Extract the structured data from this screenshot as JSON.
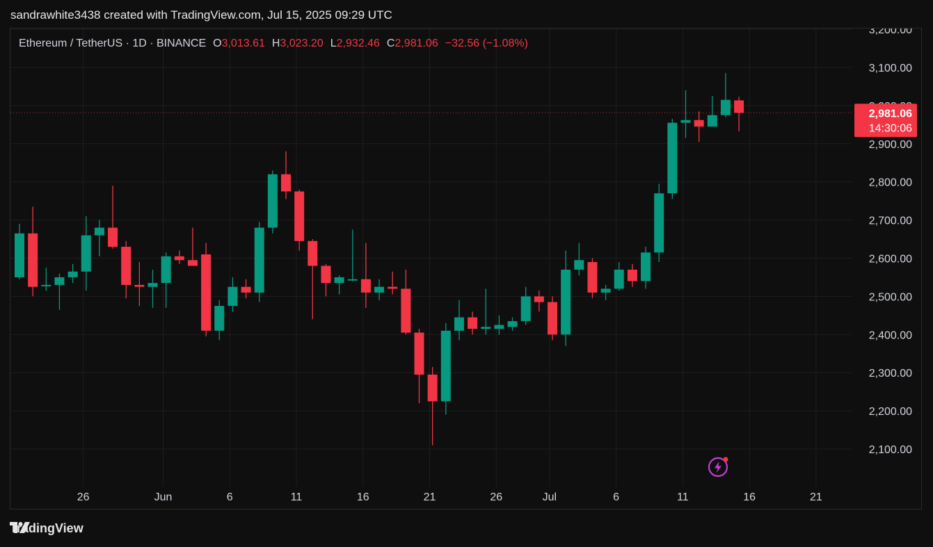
{
  "header": {
    "text": "sandrawhite3438 created with TradingView.com, Jul 15, 2025 09:29 UTC"
  },
  "legend": {
    "symbol": "Ethereum / TetherUS · 1D · BINANCE",
    "o_label": "O",
    "o_value": "3,013.61",
    "h_label": "H",
    "h_value": "3,023.20",
    "l_label": "L",
    "l_value": "2,932.46",
    "c_label": "C",
    "c_value": "2,981.06",
    "change": "−32.56 (−1.08%)"
  },
  "price_tag": {
    "price": "2,981.06",
    "countdown": "14:30:06"
  },
  "footer": {
    "brand": "TradingView"
  },
  "icons": {
    "footer_logo": "tradingview-logo-icon",
    "bolt": "lightning-icon"
  },
  "colors": {
    "up": "#089981",
    "down": "#f23645",
    "background": "#0f0f0f",
    "grid": "#1e1e1e",
    "accent": "#c13ed1"
  },
  "chart_data": {
    "type": "candlestick",
    "y_tick_labels": [
      "3,200.00",
      "3,100.00",
      "3,000.00",
      "2,900.00",
      "2,800.00",
      "2,700.00",
      "2,600.00",
      "2,500.00",
      "2,400.00",
      "2,300.00",
      "2,200.00",
      "2,100.00"
    ],
    "y_ticks": [
      3200,
      3100,
      3000,
      2900,
      2800,
      2700,
      2600,
      2500,
      2400,
      2300,
      2200,
      2100
    ],
    "x_tick_labels": [
      "26",
      "Jun",
      "6",
      "11",
      "16",
      "21",
      "26",
      "Jul",
      "6",
      "11",
      "16",
      "21"
    ],
    "last_price": 2981.06,
    "candles": [
      [
        2550,
        2690,
        2545,
        2665
      ],
      [
        2665,
        2735,
        2500,
        2525
      ],
      [
        2530,
        2575,
        2515,
        2530
      ],
      [
        2530,
        2560,
        2465,
        2550
      ],
      [
        2550,
        2585,
        2535,
        2565
      ],
      [
        2565,
        2710,
        2515,
        2660
      ],
      [
        2660,
        2700,
        2605,
        2680
      ],
      [
        2680,
        2790,
        2625,
        2630
      ],
      [
        2630,
        2645,
        2495,
        2530
      ],
      [
        2530,
        2590,
        2475,
        2525
      ],
      [
        2525,
        2570,
        2470,
        2535
      ],
      [
        2535,
        2615,
        2470,
        2605
      ],
      [
        2605,
        2620,
        2585,
        2595
      ],
      [
        2595,
        2680,
        2580,
        2580
      ],
      [
        2610,
        2640,
        2395,
        2410
      ],
      [
        2410,
        2490,
        2385,
        2475
      ],
      [
        2475,
        2550,
        2460,
        2525
      ],
      [
        2525,
        2545,
        2495,
        2510
      ],
      [
        2510,
        2695,
        2485,
        2680
      ],
      [
        2680,
        2830,
        2665,
        2820
      ],
      [
        2820,
        2880,
        2755,
        2775
      ],
      [
        2775,
        2780,
        2620,
        2645
      ],
      [
        2645,
        2650,
        2440,
        2580
      ],
      [
        2580,
        2585,
        2500,
        2535
      ],
      [
        2535,
        2555,
        2505,
        2550
      ],
      [
        2545,
        2675,
        2540,
        2545
      ],
      [
        2545,
        2640,
        2470,
        2510
      ],
      [
        2510,
        2545,
        2490,
        2525
      ],
      [
        2525,
        2565,
        2505,
        2520
      ],
      [
        2520,
        2570,
        2400,
        2405
      ],
      [
        2405,
        2415,
        2220,
        2295
      ],
      [
        2295,
        2315,
        2110,
        2225
      ],
      [
        2225,
        2430,
        2190,
        2410
      ],
      [
        2410,
        2490,
        2385,
        2445
      ],
      [
        2445,
        2460,
        2400,
        2415
      ],
      [
        2415,
        2520,
        2400,
        2420
      ],
      [
        2415,
        2450,
        2400,
        2425
      ],
      [
        2420,
        2445,
        2410,
        2435
      ],
      [
        2435,
        2525,
        2425,
        2500
      ],
      [
        2500,
        2515,
        2460,
        2485
      ],
      [
        2485,
        2500,
        2385,
        2400
      ],
      [
        2400,
        2620,
        2370,
        2570
      ],
      [
        2570,
        2640,
        2555,
        2595
      ],
      [
        2590,
        2600,
        2495,
        2510
      ],
      [
        2510,
        2530,
        2490,
        2520
      ],
      [
        2520,
        2590,
        2515,
        2570
      ],
      [
        2570,
        2585,
        2525,
        2540
      ],
      [
        2540,
        2630,
        2520,
        2615
      ],
      [
        2615,
        2795,
        2590,
        2770
      ],
      [
        2770,
        2965,
        2755,
        2955
      ],
      [
        2955,
        3040,
        2915,
        2962
      ],
      [
        2962,
        2985,
        2905,
        2945
      ],
      [
        2945,
        3025,
        2945,
        2975
      ],
      [
        2975,
        3085,
        2970,
        3015
      ],
      [
        3013.61,
        3023.2,
        2932.46,
        2981.06
      ]
    ]
  }
}
